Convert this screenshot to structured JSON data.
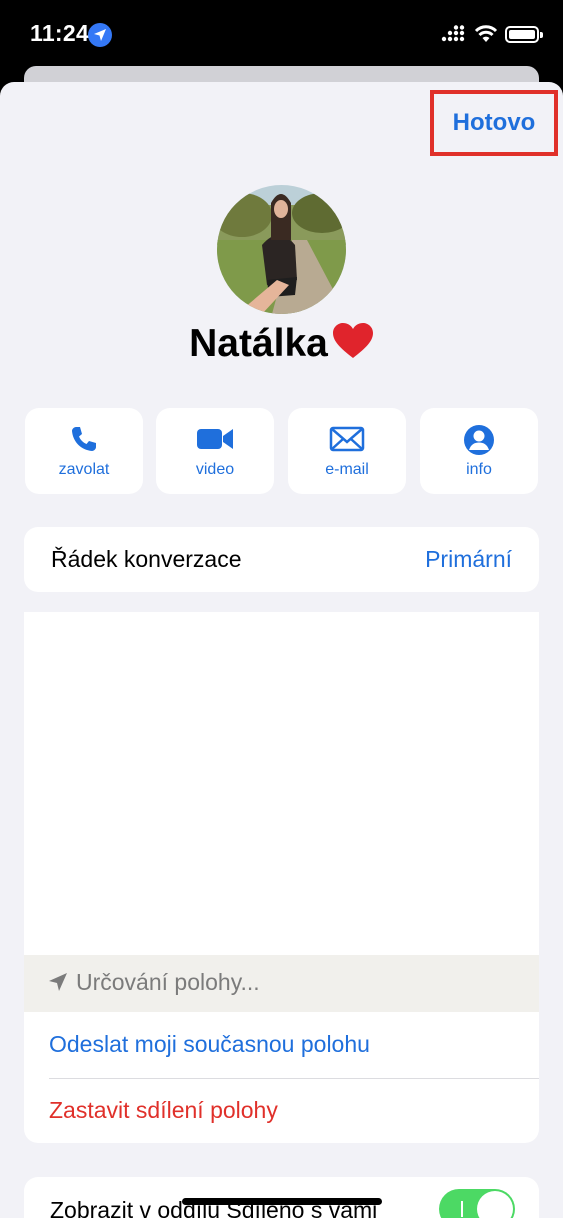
{
  "status_bar": {
    "time": "11:24"
  },
  "header": {
    "done_label": "Hotovo"
  },
  "contact": {
    "name": "Natálka",
    "name_emoji": "❤️"
  },
  "actions": [
    {
      "label": "zavolat",
      "icon": "phone-icon"
    },
    {
      "label": "video",
      "icon": "video-icon"
    },
    {
      "label": "e-mail",
      "icon": "mail-icon"
    },
    {
      "label": "info",
      "icon": "person-icon"
    }
  ],
  "conversation_row": {
    "label": "Řádek konverzace",
    "value": "Primární"
  },
  "location": {
    "status": "Určování polohy...",
    "send_label": "Odeslat moji současnou polohu",
    "stop_label": "Zastavit sdílení polohy"
  },
  "shared_with_you": {
    "label": "Zobrazit v oddílu Sdíleno s vámi",
    "enabled": true
  },
  "colors": {
    "accent": "#1f6fdc",
    "destructive": "#e0302a",
    "toggle_on": "#4cd964",
    "highlight_box": "#e0302a"
  }
}
